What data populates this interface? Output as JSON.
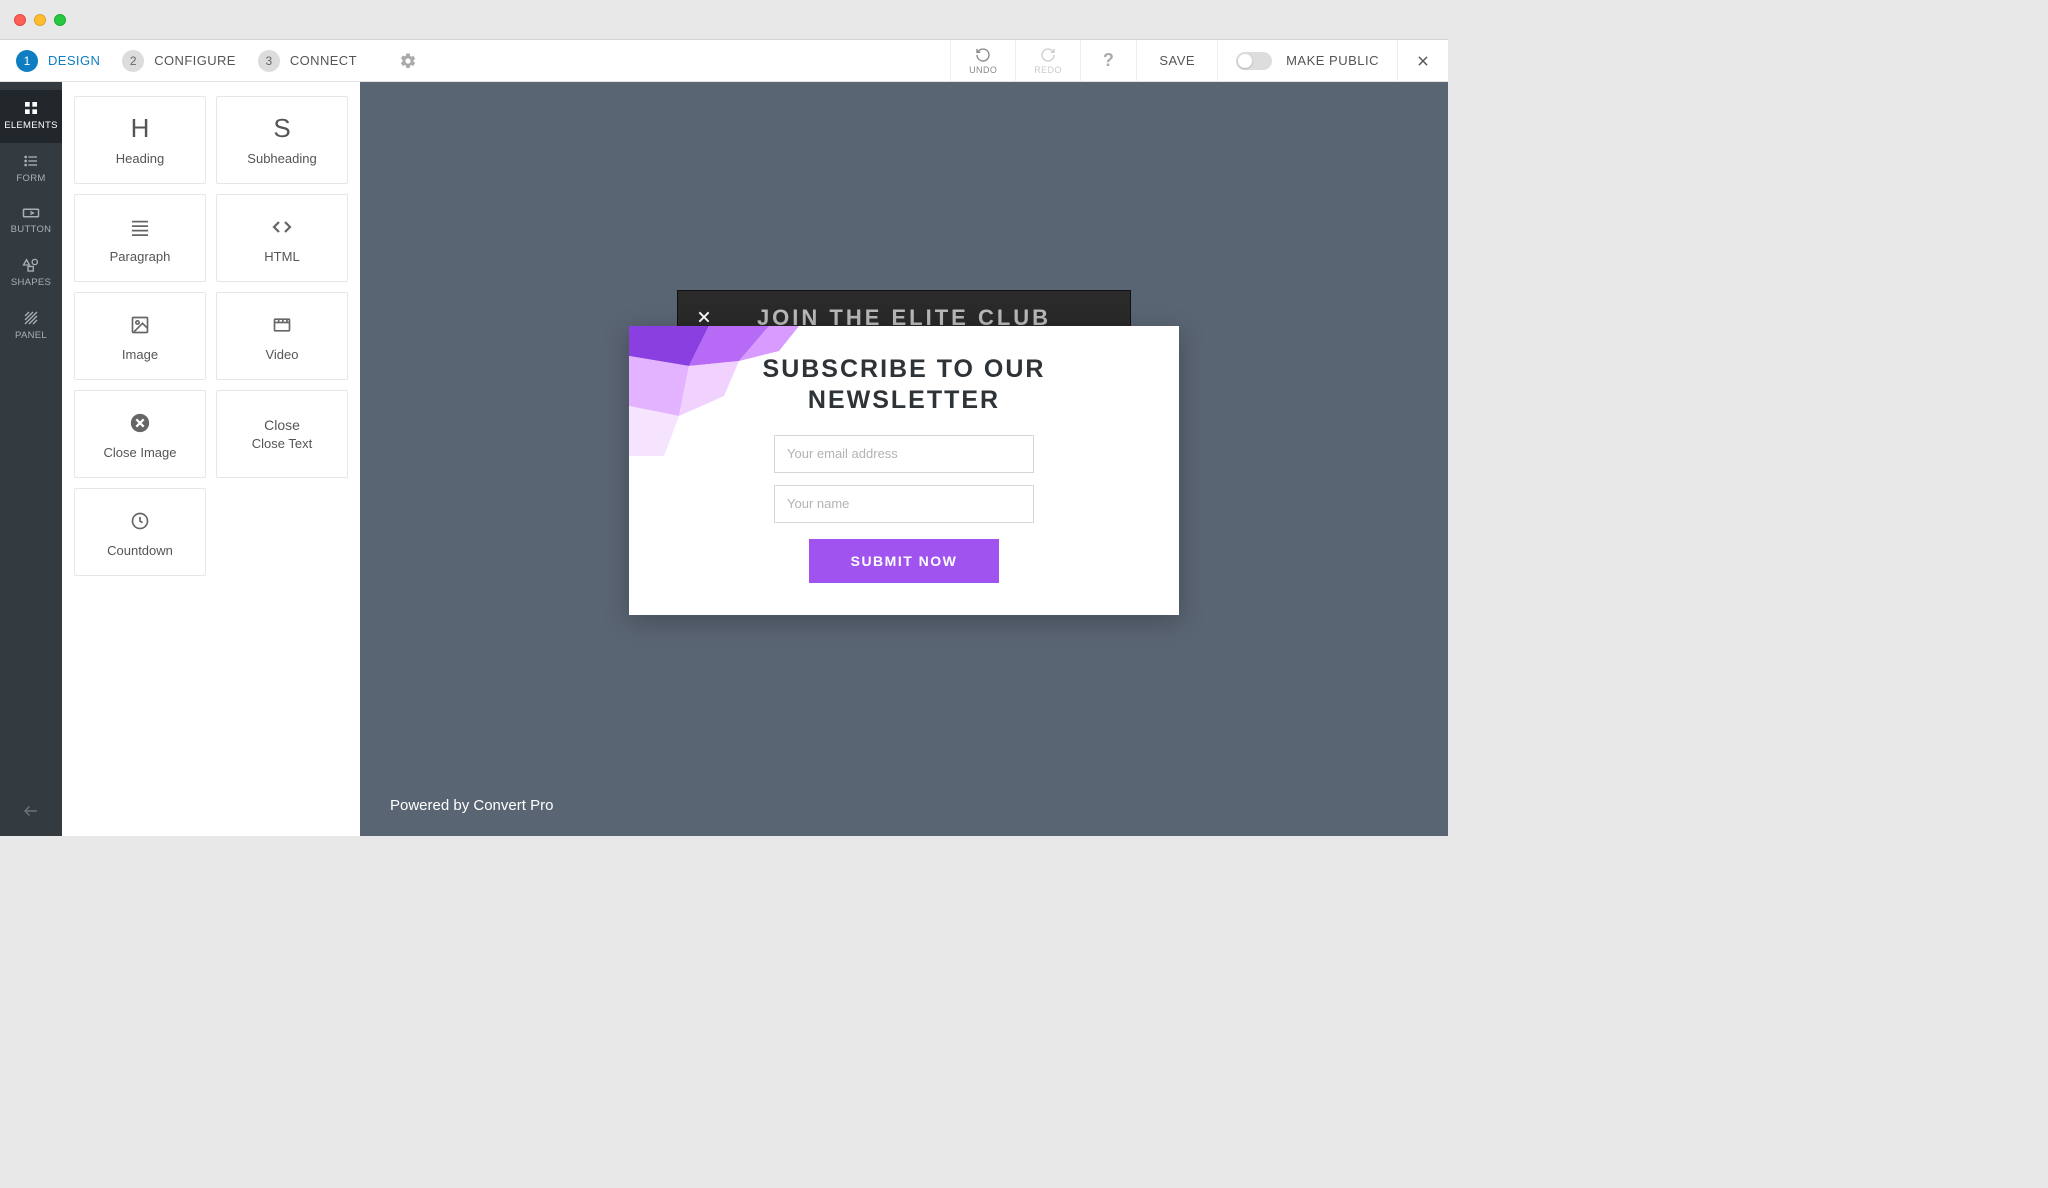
{
  "toolbar": {
    "steps": [
      {
        "num": "1",
        "label": "DESIGN"
      },
      {
        "num": "2",
        "label": "CONFIGURE"
      },
      {
        "num": "3",
        "label": "CONNECT"
      }
    ],
    "undo": "UNDO",
    "redo": "REDO",
    "save": "SAVE",
    "make_public": "MAKE PUBLIC"
  },
  "vnav": {
    "elements": "ELEMENTS",
    "form": "FORM",
    "button": "BUTTON",
    "shapes": "SHAPES",
    "panel": "PANEL"
  },
  "elements_panel": {
    "heading_icon": "H",
    "heading": "Heading",
    "subheading_icon": "S",
    "subheading": "Subheading",
    "paragraph": "Paragraph",
    "html": "HTML",
    "image": "Image",
    "video": "Video",
    "close_image": "Close Image",
    "close_title": "Close",
    "close_text": "Close Text",
    "countdown": "Countdown"
  },
  "canvas": {
    "bg_title": "JOIN THE ELITE CLUB",
    "popup_title_line1": "SUBSCRIBE TO OUR",
    "popup_title_line2": "NEWSLETTER",
    "email_placeholder": "Your email address",
    "name_placeholder": "Your name",
    "submit": "SUBMIT NOW",
    "footer": "Powered by Convert Pro"
  },
  "colors": {
    "accent": "#a053ef",
    "step_active": "#0e7dc2",
    "canvas_bg": "#5a6573"
  }
}
